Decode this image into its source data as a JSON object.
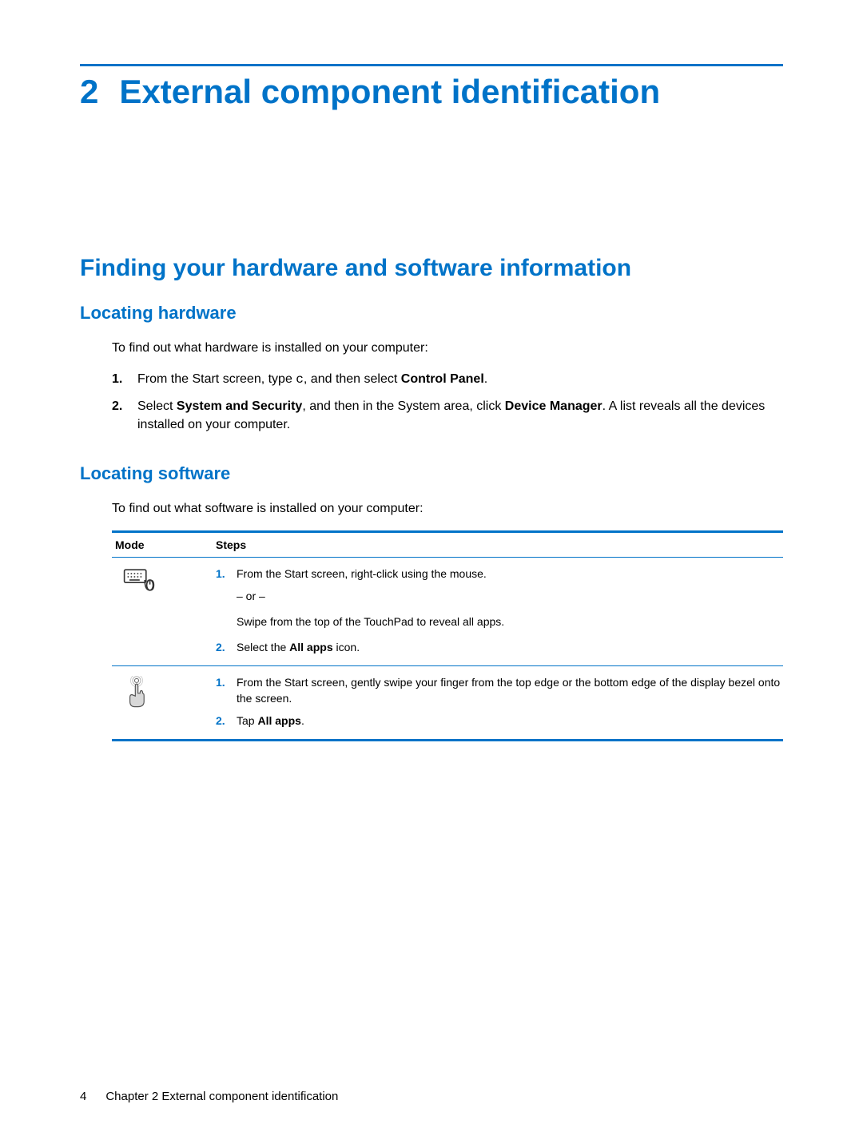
{
  "chapter": {
    "number": "2",
    "title": "External component identification"
  },
  "section1": {
    "title": "Finding your hardware and software information"
  },
  "hwSection": {
    "title": "Locating hardware",
    "intro": "To find out what hardware is installed on your computer:",
    "step1": {
      "num": "1.",
      "p1": "From the Start screen, type ",
      "code": "c",
      "p2": ", and then select ",
      "bold": "Control Panel",
      "p3": "."
    },
    "step2": {
      "num": "2.",
      "p1": "Select ",
      "b1": "System and Security",
      "p2": ", and then in the System area, click ",
      "b2": "Device Manager",
      "p3": ". A list reveals all the devices installed on your computer."
    }
  },
  "swSection": {
    "title": "Locating software",
    "intro": "To find out what software is installed on your computer:"
  },
  "table": {
    "headers": {
      "mode": "Mode",
      "steps": "Steps"
    },
    "row1": {
      "s1num": "1.",
      "s1txt": "From the Start screen, right-click using the mouse.",
      "or": "– or –",
      "s1b": "Swipe from the top of the TouchPad to reveal all apps.",
      "s2num": "2.",
      "s2p1": "Select the ",
      "s2b": "All apps",
      "s2p2": " icon."
    },
    "row2": {
      "s1num": "1.",
      "s1txt": "From the Start screen, gently swipe your finger from the top edge or the bottom edge of the display bezel onto the screen.",
      "s2num": "2.",
      "s2p1": "Tap ",
      "s2b": "All apps",
      "s2p2": "."
    }
  },
  "footer": {
    "pageNum": "4",
    "text": "Chapter 2   External component identification"
  }
}
